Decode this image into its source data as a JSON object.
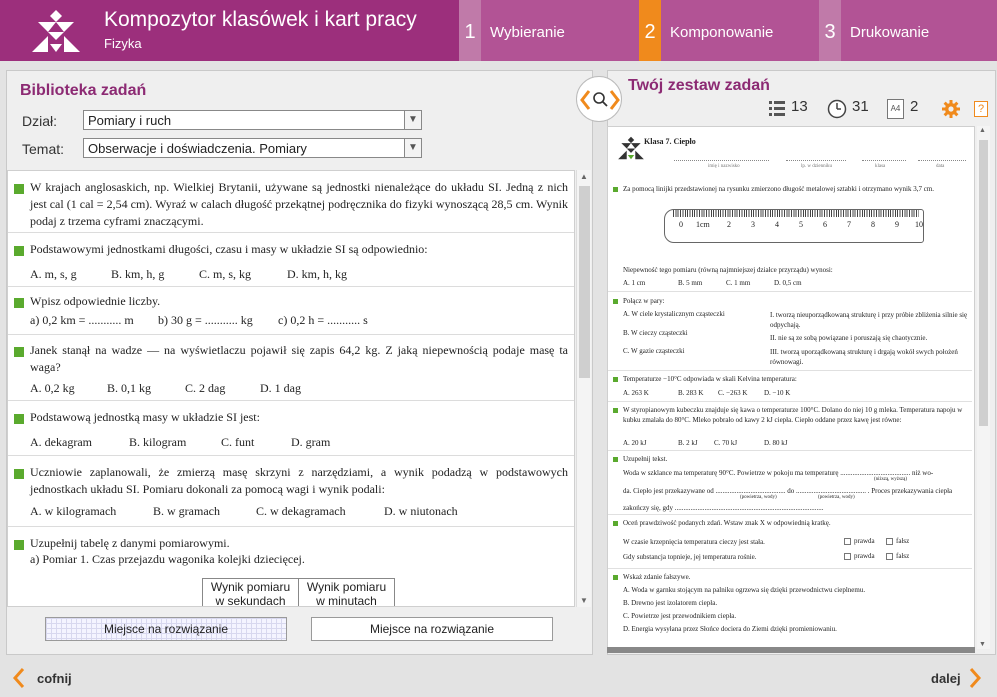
{
  "header": {
    "app_title": "Kompozytor klasówek i kart pracy",
    "subtitle": "Fizyka",
    "steps": [
      {
        "num": "1",
        "label": "Wybieranie"
      },
      {
        "num": "2",
        "label": "Komponowanie"
      },
      {
        "num": "3",
        "label": "Drukowanie"
      }
    ]
  },
  "library": {
    "title": "Biblioteka zadań",
    "dzial_label": "Dział:",
    "dzial_value": "Pomiary i ruch",
    "temat_label": "Temat:",
    "temat_value": "Obserwacje i doświadczenia. Pomiary",
    "tasks": [
      {
        "text": "W krajach anglosaskich, np. Wielkiej Brytanii, używane są jednostki nienależące do układu SI. Jedną z nich jest cal (1 cal = 2,54 cm). Wyraź w calach długość przekątnej podręcznika do fizyki wynoszącą 28,5 cm. Wynik podaj z trzema cyframi znaczącymi."
      },
      {
        "text": "Podstawowymi jednostkami długości, czasu i masy w układzie SI są odpowiednio:",
        "answers": [
          "A. m, s, g",
          "B. km, h, g",
          "C. m, s, kg",
          "D. km, h, kg"
        ]
      },
      {
        "text": "Wpisz odpowiednie liczby.",
        "answers": [
          "a)  0,2 km = ........... m",
          "b)  30 g = ........... kg",
          "c)  0,2 h = ........... s"
        ]
      },
      {
        "text": "Janek stanął na wadze — na wyświetlaczu pojawił się zapis 64,2 kg. Z jaką niepewnością podaje masę ta waga?",
        "answers": [
          "A. 0,2 kg",
          "B. 0,1 kg",
          "C. 2 dag",
          "D. 1 dag"
        ]
      },
      {
        "text": "Podstawową jednostką masy w układzie SI jest:",
        "answers": [
          "A. dekagram",
          "B. kilogram",
          "C. funt",
          "D. gram"
        ]
      },
      {
        "text": "Uczniowie zaplanowali, że zmierzą masę skrzyni z narzędziami, a wynik podadzą w podstawowych jednostkach układu SI. Pomiaru dokonali za pomocą wagi i wynik podali:",
        "answers": [
          "A. w kilogramach",
          "B. w gramach",
          "C. w dekagramach",
          "D. w niutonach"
        ]
      },
      {
        "text": "Uzupełnij tabelę z danymi pomiarowymi.",
        "sub": "a)  Pomiar 1. Czas przejazdu wagonika kolejki dziecięcej.",
        "table_headers": [
          "Wynik pomiaru w sekundach",
          "Wynik pomiaru w minutach"
        ]
      }
    ],
    "btn_grid": "Miejsce na rozwiązanie",
    "btn_plain": "Miejsce na rozwiązanie"
  },
  "set": {
    "title": "Twój zestaw zadań",
    "count_tasks": "13",
    "count_minutes": "31",
    "pages_label": "A4",
    "count_pages": "2",
    "help": "?"
  },
  "preview": {
    "heading": "Klasa 7. Ciepło",
    "fields": [
      "imię i nazwisko",
      "lp. w dzienniku",
      "klasa",
      "data"
    ],
    "blocks": [
      {
        "text": "Za pomocą linijki przedstawionej na rysunku zmierzono długość metalowej sztabki i otrzymano wynik 3,7 cm.",
        "ruler_labels": [
          "0",
          "1cm",
          "2",
          "3",
          "4",
          "5",
          "6",
          "7",
          "8",
          "9",
          "10"
        ],
        "after": "Niepewność tego pomiaru (równą najmniejszej działce przyrządu) wynosi:",
        "answers": [
          "A. 1 cm",
          "B. 5 mm",
          "C. 1 mm",
          "D. 0,5 cm"
        ]
      },
      {
        "text": "Połącz w pary:",
        "left": [
          "A. W ciele krystalicznym cząsteczki",
          "B. W cieczy cząsteczki",
          "C. W gazie cząsteczki"
        ],
        "right": [
          "I. tworzą nieuporządkowaną strukturę i przy próbie zbliżenia silnie się odpychają.",
          "II. nie są ze sobą powiązane i poruszają się chaotycznie.",
          "III. tworzą uporządkowaną strukturę i drgają wokół swych położeń równowagi."
        ]
      },
      {
        "text": "Temperaturze −10°C odpowiada w skali Kelvina temperatura:",
        "answers": [
          "A. 263 K",
          "B. 283 K",
          "C. −263 K",
          "D. −10 K"
        ]
      },
      {
        "text": "W styropianowym kubeczku znajduje się kawa o temperaturze 100°C. Dolano do niej 10 g mleka. Temperatura napoju w kubku zmalała do 80°C. Mleko pobrało od kawy 2 kJ ciepła. Ciepło oddane przez kawę jest równe:",
        "answers": [
          "A. 20 kJ",
          "B. 2 kJ",
          "C. 70 kJ",
          "D. 80 kJ"
        ]
      },
      {
        "text": "Uzupełnij tekst.",
        "lines": [
          "Woda w szklance ma temperaturę 90°C. Powietrze w pokoju ma temperaturę ........................................ niż wo-",
          "da. Ciepło jest przekazywane od ........................................ do ........................................ . Proces przekazywania ciepła",
          "zakończy się, gdy ....................................................................................."
        ],
        "hints": [
          "(niższą, wyższą)",
          "(powietrza, wody)",
          "(powietrza, wody)"
        ]
      },
      {
        "text": "Oceń prawdziwość podanych zdań. Wstaw znak X w odpowiednią kratkę.",
        "rows": [
          "W czasie krzepnięcia temperatura cieczy jest stała.",
          "Gdy substancja topnieje, jej temperatura rośnie."
        ],
        "true_label": "prawda",
        "false_label": "fałsz"
      },
      {
        "text": "Wskaż zdanie fałszywe.",
        "options": [
          "A. Woda w garnku stojącym na palniku ogrzewa się dzięki przewodnictwu cieplnemu.",
          "B. Drewno jest izolatorem ciepła.",
          "C. Powietrze jest przewodnikiem ciepła.",
          "D. Energia wysyłana przez Słońce dociera do Ziemi dzięki promieniowaniu."
        ]
      }
    ]
  },
  "footer": {
    "back": "cofnij",
    "next": "dalej"
  },
  "colors": {
    "header": "#9c2f7c",
    "step": "#b25395",
    "active_step": "#f08a1c",
    "square": "#5aaa2e",
    "accent": "#f08a1c"
  }
}
